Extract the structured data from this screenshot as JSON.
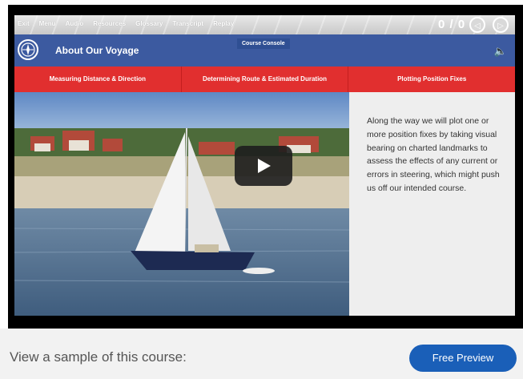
{
  "menu": [
    "Exit",
    "Menu",
    "Audio",
    "Resources",
    "Glossary",
    "Transcript",
    "Replay"
  ],
  "counter": "0 / 0",
  "header": {
    "title": "About Our Voyage",
    "console_label": "Course Console"
  },
  "tabs": [
    "Measuring Distance & Direction",
    "Determining Route & Estimated Duration",
    "Plotting Position Fixes"
  ],
  "body_text": "Along the way we will plot one or more position fixes by taking visual bearing on charted landmarks to assess the effects of any current or errors in steering, which might push us off our intended course.",
  "bottom": {
    "sample_text": "View a sample of this course:",
    "preview_label": "Free Preview"
  },
  "colors": {
    "header": "#3c5aa0",
    "tabs": "#e12f2f",
    "preview_button": "#1a5fb8"
  },
  "icons": {
    "logo": "compass-icon",
    "prev": "prev-arrow-icon",
    "next": "next-arrow-icon",
    "play": "play-icon",
    "mute": "speaker-mute-icon"
  }
}
